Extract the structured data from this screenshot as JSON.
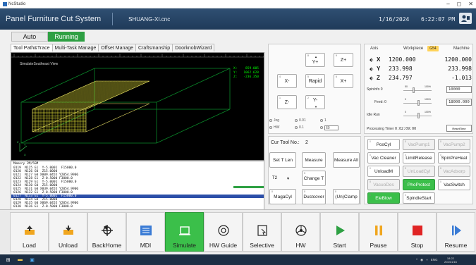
{
  "window": {
    "app_name": "NcStudio",
    "min": "–",
    "max": "◻",
    "close": "✕"
  },
  "header": {
    "title": "Panel Furniture Cut System",
    "file": "SHUANG-XI.cnc",
    "date": "1/16/2024",
    "time": "6:22:07 PM"
  },
  "modes": {
    "auto": "Auto",
    "running": "Running"
  },
  "tabs": [
    "Tool Path&Trace",
    "Multi-Task Manage",
    "Offset Manage",
    "Craftsmanship",
    "DoorknobWizard"
  ],
  "viewport": {
    "view_name": "SimulateSoutheast View",
    "coords": [
      {
        "axis": "X:",
        "val": "859.005"
      },
      {
        "axis": "Y:",
        "val": "1062.628"
      },
      {
        "axis": "Z:",
        "val": "-236.350"
      }
    ]
  },
  "gcode": {
    "memory": "Memory 2M/5GM",
    "lines": [
      "0119  N125 G1  Y-5.0001  F15000.0",
      "0120  N126 G0  Z15.0000",
      "0121  N127 G0 X809.0455 Y2054.9906",
      "0122  N128 G1  Z-0.5000 F3000.0",
      "0123  N129 G1  Y-5.0001  F15000.0",
      "0124  N130 G0  Z15.0000",
      "0125  N131 G0 X839.0455 Y2054.9906",
      "0126  N132 G1  Z-0.5000 F3000.0",
      "0127  N133 G1  Y-5.0001  F15000.0",
      "0128  N134 G0  Z15.0000",
      "0129  N135 G0 X869.0455 Y2054.9906",
      "0130  N136 G1  Z-0.5000 F3000.0"
    ],
    "highlight_index": 8
  },
  "jog": {
    "yplus": "Y+",
    "zplus": "Z+",
    "xminus": "X-",
    "rapid": "Rapid",
    "xplus": "X+",
    "zminus": "Z-",
    "yminus": "Y-",
    "m_yplus": "8",
    "m_zplus": "9",
    "m_xminus": "4",
    "m_rapid": "5",
    "m_xplus": "6",
    "m_zminus": "1",
    "m_yminus": "2",
    "opt_jog": "Jog",
    "opt_001": "0.01",
    "opt_1": "1",
    "opt_hw": "HW",
    "opt_01": "0.1",
    "step_val": "60"
  },
  "tool": {
    "cur_label": "Cur Tool No.:",
    "cur_val": "2",
    "set_len": "Set T Len",
    "measure": "Measure",
    "measure_all": "Measure All",
    "t_select": "T2",
    "change_t": "Change T",
    "magacyl": "MagaCyl",
    "dustcover": "Dustcover",
    "unclamp": "(Un)Clamp"
  },
  "coords": {
    "axis_head": "Axis",
    "wp_head": "Workpiece",
    "g54": "G54",
    "mc_head": "Machine",
    "axes": [
      {
        "name": "X",
        "wp": "1200.000",
        "mc": "1200.000"
      },
      {
        "name": "Y",
        "wp": "233.998",
        "mc": "233.998"
      },
      {
        "name": "Z",
        "wp": "234.797",
        "mc": "-1.013"
      }
    ],
    "spin_label": "SpinInfo 0",
    "spin_min": "50",
    "spin_max": "100%",
    "spin_val": "10000",
    "feed_label": "Feed: 0",
    "feed_min": "0",
    "feed_max": "100%",
    "feed_val": "18000.000",
    "idle_label": "Idle Run",
    "idle_min": "0",
    "idle_max": "100%",
    "proc_label": "Processing Timer",
    "proc_val": "0:02:09:00",
    "reset": "ResetTime"
  },
  "funcs": [
    {
      "label": "PosCyl",
      "state": "normal"
    },
    {
      "label": "VacPump1",
      "state": "dis"
    },
    {
      "label": "VacPump2",
      "state": "dis"
    },
    {
      "label": "Vac Cleaner",
      "state": "normal"
    },
    {
      "label": "LimitRelease",
      "state": "normal"
    },
    {
      "label": "SpinPreHeat",
      "state": "normal"
    },
    {
      "label": "UnloadM",
      "state": "normal"
    },
    {
      "label": "UnLoadCyl",
      "state": "dis"
    },
    {
      "label": "VacAdsorp",
      "state": "dis"
    },
    {
      "label": "VacuoDes",
      "state": "dis"
    },
    {
      "label": "PhoProtect",
      "state": "on"
    },
    {
      "label": "VacSwitch",
      "state": "normal"
    },
    {
      "label": "EleBlow",
      "state": "on"
    },
    {
      "label": "SpindleStart",
      "state": "normal"
    }
  ],
  "bottom": [
    "Load",
    "Unload",
    "BackHome",
    "MDI",
    "Simulate",
    "HW Guide",
    "Selective",
    "HW",
    "Start",
    "Pause",
    "Stop",
    "Resume"
  ],
  "taskbar": {
    "tray": "ENG",
    "clock_time": "18:22",
    "clock_date": "2024/1/16"
  }
}
